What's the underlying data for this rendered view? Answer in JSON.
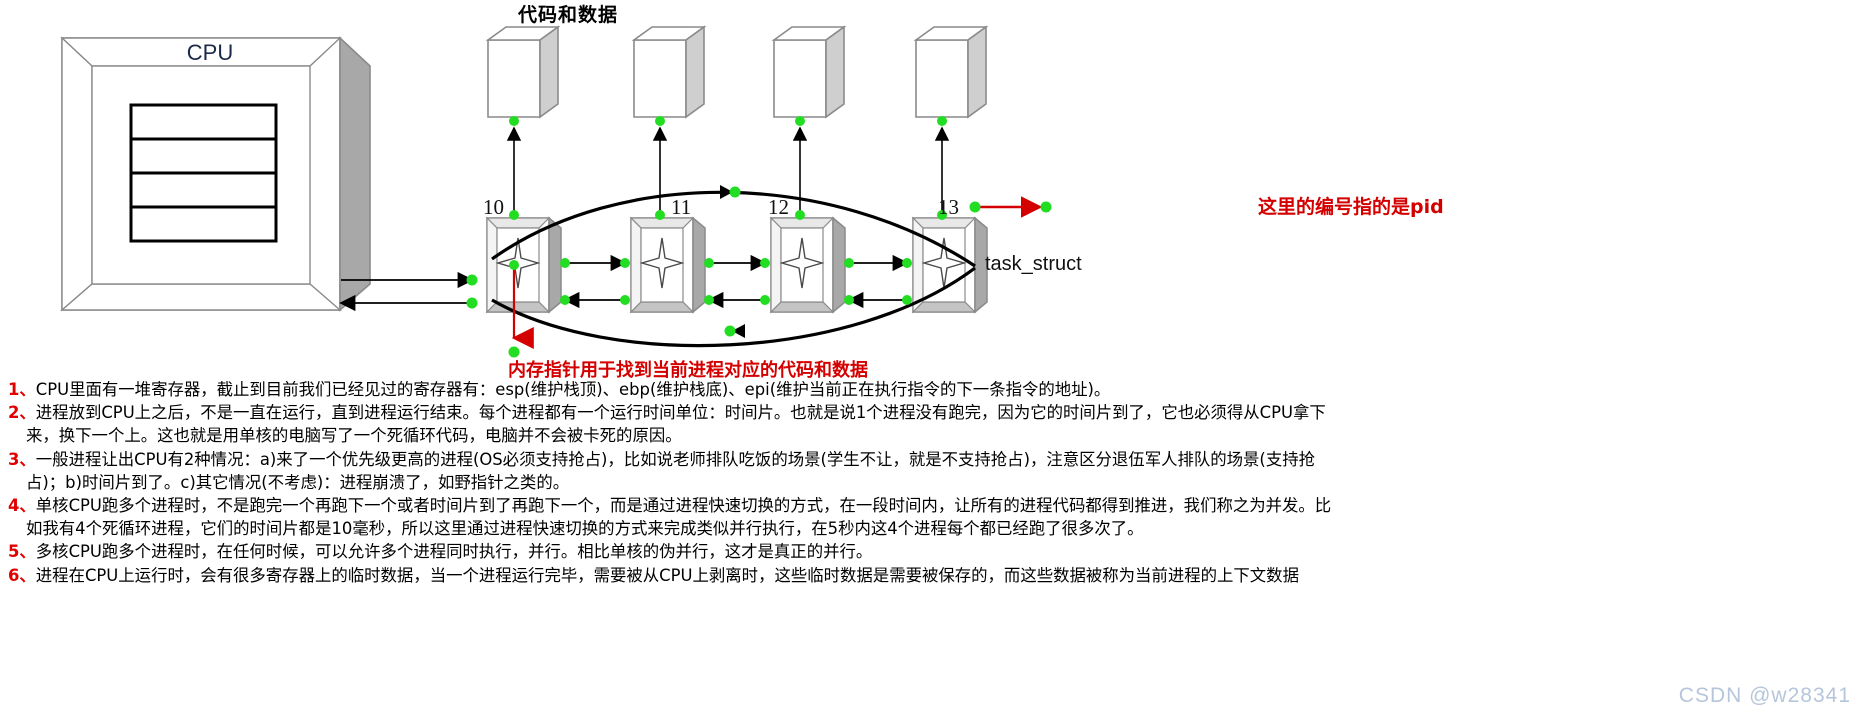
{
  "diagram": {
    "title_codedata": "代码和数据",
    "cpu_label": "CPU",
    "task_struct_label": "task_struct",
    "pid_note": "这里的编号指的是pid",
    "mem_pointer_note": "内存指针用于找到当前进程对应的代码和数据",
    "nodes": [
      {
        "id": "10",
        "label": "10"
      },
      {
        "id": "11",
        "label": "11"
      },
      {
        "id": "12",
        "label": "12"
      },
      {
        "id": "13",
        "label": "13"
      }
    ],
    "cpu_register_rows": 4,
    "memory_blocks": 4,
    "colors": {
      "accent_red": "#d40000",
      "node_dot_green": "#22dd22",
      "box_fill": "#ffffff",
      "box_shade": "#a8a8a8",
      "outline": "#7a7a7a",
      "line_black": "#000000"
    }
  },
  "notes": {
    "items": [
      {
        "num": "1、",
        "text": "CPU里面有一堆寄存器，截止到目前我们已经见过的寄存器有：esp(维护栈顶)、ebp(维护栈底)、epi(维护当前正在执行指令的下一条指令的地址)。",
        "cont": []
      },
      {
        "num": "2、",
        "text": "进程放到CPU上之后，不是一直在运行，直到进程运行结束。每个进程都有一个运行时间单位：时间片。也就是说1个进程没有跑完，因为它的时间片到了，它也必须得从CPU拿下",
        "cont": [
          "来，换下一个上。这也就是用单核的电脑写了一个死循环代码，电脑并不会被卡死的原因。"
        ]
      },
      {
        "num": "3、",
        "text": "一般进程让出CPU有2种情况：a)来了一个优先级更高的进程(OS必须支持抢占)，比如说老师排队吃饭的场景(学生不让，就是不支持抢占)，注意区分退伍军人排队的场景(支持抢",
        "cont": [
          "占)；b)时间片到了。c)其它情况(不考虑)：进程崩溃了，如野指针之类的。"
        ]
      },
      {
        "num": "4、",
        "text": "单核CPU跑多个进程时，不是跑完一个再跑下一个或者时间片到了再跑下一个，而是通过进程快速切换的方式，在一段时间内，让所有的进程代码都得到推进，我们称之为并发。比",
        "cont": [
          "如我有4个死循环进程，它们的时间片都是10毫秒，所以这里通过进程快速切换的方式来完成类似并行执行，在5秒内这4个进程每个都已经跑了很多次了。"
        ]
      },
      {
        "num": "5、",
        "text": "多核CPU跑多个进程时，在任何时候，可以允许多个进程同时执行，并行。相比单核的伪并行，这才是真正的并行。",
        "cont": []
      },
      {
        "num": "6、",
        "text": "进程在CPU上运行时，会有很多寄存器上的临时数据，当一个进程运行完毕，需要被从CPU上剥离时，这些临时数据是需要被保存的，而这些数据被称为当前进程的上下文数据",
        "cont": []
      }
    ]
  },
  "watermark": {
    "text": "CSDN @w28341"
  }
}
